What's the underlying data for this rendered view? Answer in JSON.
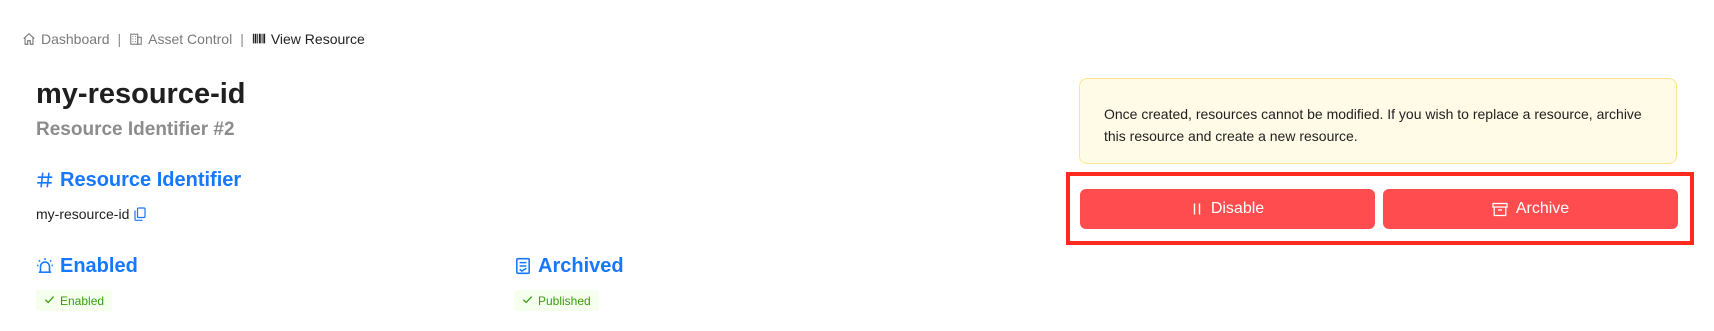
{
  "breadcrumb": {
    "items": [
      {
        "label": "Dashboard",
        "icon": "home-icon"
      },
      {
        "label": "Asset Control",
        "icon": "building-icon"
      },
      {
        "label": "View Resource",
        "icon": "barcode-icon"
      }
    ],
    "separator": "|"
  },
  "resource": {
    "title": "my-resource-id",
    "subtitle": "Resource Identifier #2"
  },
  "sections": {
    "identifier": {
      "heading": "Resource Identifier",
      "icon": "hash-icon",
      "value": "my-resource-id",
      "copy_icon": "copy-icon"
    },
    "enabled": {
      "heading": "Enabled",
      "icon": "alarm-light-icon",
      "status": "Enabled",
      "status_icon": "check-icon"
    },
    "archived": {
      "heading": "Archived",
      "icon": "document-archive-icon",
      "status": "Published",
      "status_icon": "check-icon"
    }
  },
  "notice": {
    "text": "Once created, resources cannot be modified. If you wish to replace a resource, archive this resource and create a new resource."
  },
  "actions": {
    "disable_label": "Disable",
    "disable_icon": "pause-icon",
    "archive_label": "Archive",
    "archive_icon": "archive-box-icon"
  },
  "colors": {
    "primary": "#1677ff",
    "danger": "#ff4d4f",
    "highlight": "#ff2a1f",
    "success_text": "#389e0d",
    "success_bg": "#f6ffed",
    "warning_bg": "#fffbe6",
    "warning_border": "#ffe58f"
  }
}
